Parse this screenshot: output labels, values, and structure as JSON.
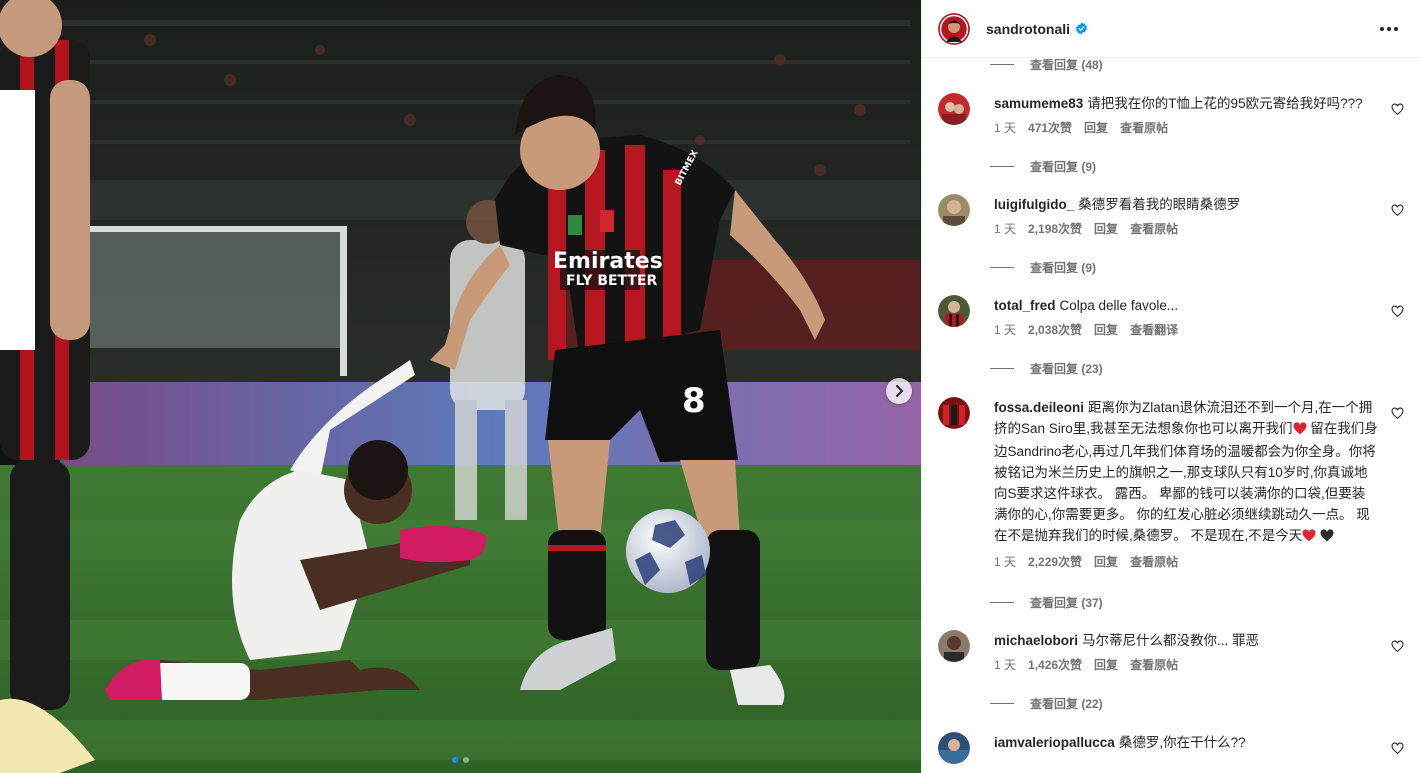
{
  "post": {
    "username": "sandrotonali",
    "verified": true,
    "carousel": {
      "total": 2,
      "active": 1
    }
  },
  "photo": {
    "jersey_sponsor_top": "Emirates",
    "jersey_sponsor_bottom": "FLY BETTER",
    "jersey_number": "8",
    "sleeve_sponsor": "BITMEX"
  },
  "comments": [
    {
      "type": "replies",
      "label": "查看回复 (48)"
    },
    {
      "type": "comment",
      "author": "samumeme83",
      "text": "请把我在你的T恤上花的95欧元寄给我好吗???",
      "time": "1 天",
      "likes": "471次赞",
      "reply": "回复",
      "action": "查看原帖",
      "avatar_color": "#c22b2b"
    },
    {
      "type": "replies",
      "label": "查看回复 (9)"
    },
    {
      "type": "comment",
      "author": "luigifulgido_",
      "text": "桑德罗看着我的眼睛桑德罗",
      "time": "1 天",
      "likes": "2,198次赞",
      "reply": "回复",
      "action": "查看原帖",
      "avatar_color": "#8a7a5a"
    },
    {
      "type": "replies",
      "label": "查看回复 (9)"
    },
    {
      "type": "comment",
      "author": "total_fred",
      "text": "Colpa delle favole...",
      "time": "1 天",
      "likes": "2,038次赞",
      "reply": "回复",
      "action": "查看翻译",
      "avatar_color": "#3a4a2a"
    },
    {
      "type": "replies",
      "label": "查看回复 (23)"
    },
    {
      "type": "comment",
      "author": "fossa.deileoni",
      "text_parts": [
        "距离你为Zlatan退休流泪还不到一个月,在一个拥挤的San Siro里,我甚至无法想象你也可以离开我们",
        " 留在我们身边Sandrino老心,再过几年我们体育场的温暖都会为你全身。你将被铭记为米兰历史上的旗帜之一,那支球队只有10岁时,你真诚地向S要求这件球衣。 露西。 卑鄙的钱可以装满你的口袋,但要装满你的心,你需要更多。 你的红发心脏必须继续跳动久一点。 现在不是抛弃我们的时候,桑德罗。 不是现在,不是今天",
        ""
      ],
      "time": "1 天",
      "likes": "2,229次赞",
      "reply": "回复",
      "action": "查看原帖",
      "avatar_color": "#b02020",
      "emoji_colors": [
        "#e0242f",
        "#e0242f",
        "#2b2b2b"
      ]
    },
    {
      "type": "replies",
      "label": "查看回复 (37)"
    },
    {
      "type": "comment",
      "author": "michaelobori",
      "text": "马尔蒂尼什么都没教你... 罪恶",
      "time": "1 天",
      "likes": "1,426次赞",
      "reply": "回复",
      "action": "查看原帖",
      "avatar_color": "#3d2f28"
    },
    {
      "type": "replies",
      "label": "查看回复 (22)"
    },
    {
      "type": "comment",
      "author": "iamvaleriopallucca",
      "text": "桑德罗,你在干什么??",
      "avatar_color": "#2a4f7a"
    }
  ]
}
